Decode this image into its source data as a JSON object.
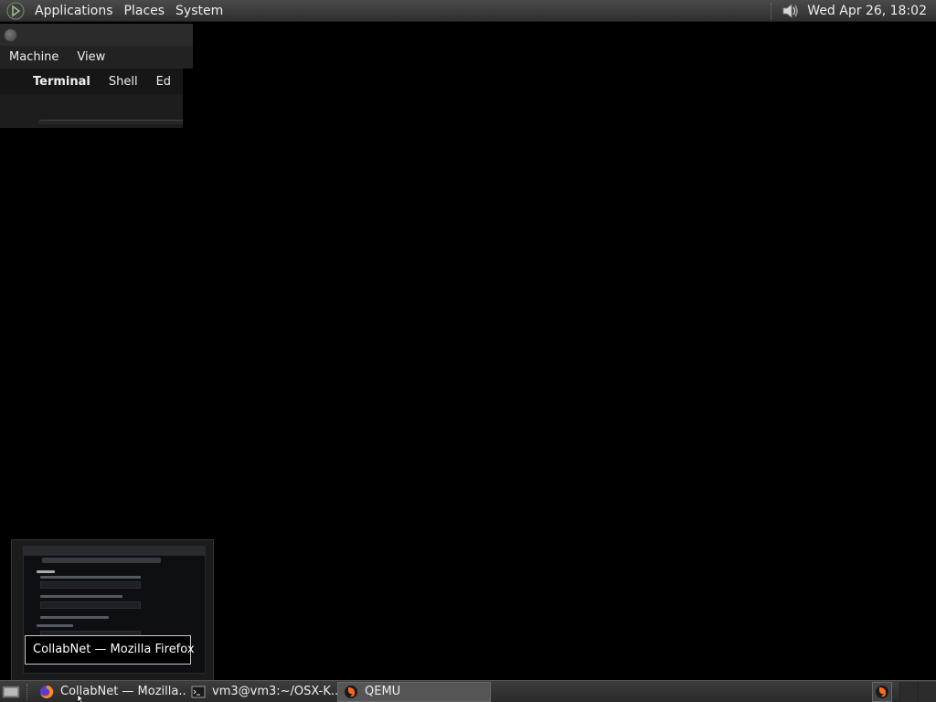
{
  "top_panel": {
    "menus": [
      "Applications",
      "Places",
      "System"
    ],
    "clock": "Wed Apr 26, 18:02"
  },
  "qemu_window": {
    "menus": [
      "Machine",
      "View"
    ],
    "guest_menubar": {
      "app_name": "Terminal",
      "items": [
        "Shell",
        "Ed"
      ]
    }
  },
  "preview": {
    "tooltip": "CollabNet — Mozilla Firefox"
  },
  "taskbar": {
    "tasks": [
      {
        "label": "CollabNet — Mozilla...",
        "icon": "firefox-icon",
        "active": false
      },
      {
        "label": "vm3@vm3:~/OSX-K...",
        "icon": "terminal-icon",
        "active": false
      },
      {
        "label": "QEMU",
        "icon": "qemu-icon",
        "active": true
      }
    ]
  }
}
